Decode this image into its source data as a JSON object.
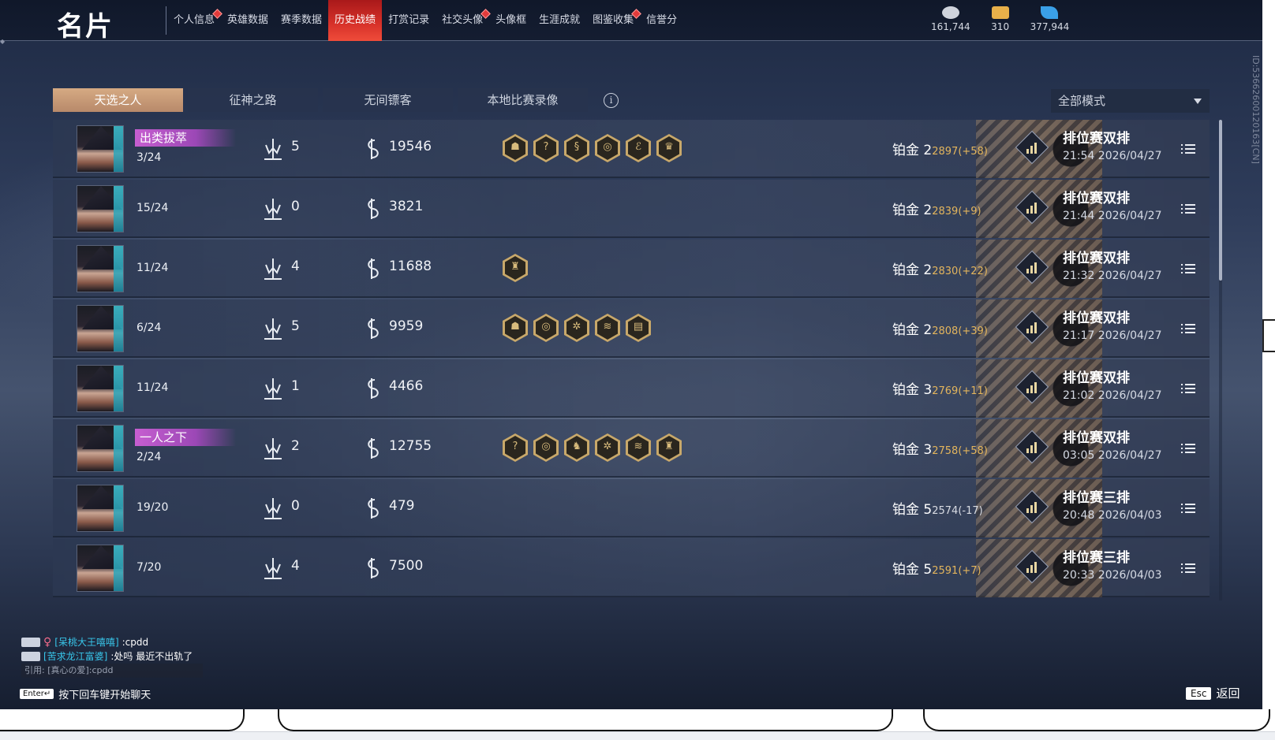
{
  "app": {
    "title": "名片",
    "nav": [
      {
        "label": "个人信息",
        "badge": true,
        "active": false
      },
      {
        "label": "英雄数据",
        "badge": false,
        "active": false
      },
      {
        "label": "赛季数据",
        "badge": false,
        "active": false
      },
      {
        "label": "历史战绩",
        "badge": false,
        "active": true
      },
      {
        "label": "打赏记录",
        "badge": false,
        "active": false
      },
      {
        "label": "社交头像",
        "badge": true,
        "active": false
      },
      {
        "label": "头像框",
        "badge": false,
        "active": false
      },
      {
        "label": "生涯成就",
        "badge": false,
        "active": false
      },
      {
        "label": "图鉴收集",
        "badge": true,
        "active": false
      },
      {
        "label": "信誉分",
        "badge": false,
        "active": false
      }
    ],
    "currencies": [
      {
        "icon": "coin-stack-icon",
        "value": "161,744"
      },
      {
        "icon": "ticket-icon",
        "value": "310"
      },
      {
        "icon": "feather-icon",
        "value": "377,944"
      }
    ],
    "side_id": "ID:536626001201​63[CN]"
  },
  "tabs": [
    {
      "label": "天选之人",
      "active": true
    },
    {
      "label": "征神之路",
      "active": false
    },
    {
      "label": "无间镖客",
      "active": false
    },
    {
      "label": "本地比赛录像",
      "active": false
    }
  ],
  "mode_select": {
    "value": "全部模式"
  },
  "matches": [
    {
      "title": "出类拔萃",
      "rank": "3/24",
      "kills": "5",
      "damage": "19546",
      "badges": [
        "☗",
        "?",
        "§",
        "◎",
        "ℰ",
        "♛"
      ],
      "tier": "铂金 2",
      "score": "2897(+58)",
      "negative": false,
      "mode": "排位赛双排",
      "time": "21:54  2026/04/27"
    },
    {
      "title": "",
      "rank": "15/24",
      "kills": "0",
      "damage": "3821",
      "badges": [],
      "tier": "铂金 2",
      "score": "2839(+9)",
      "negative": false,
      "mode": "排位赛双排",
      "time": "21:44  2026/04/27"
    },
    {
      "title": "",
      "rank": "11/24",
      "kills": "4",
      "damage": "11688",
      "badges": [
        "♜"
      ],
      "tier": "铂金 2",
      "score": "2830(+22)",
      "negative": false,
      "mode": "排位赛双排",
      "time": "21:32  2026/04/27"
    },
    {
      "title": "",
      "rank": "6/24",
      "kills": "5",
      "damage": "9959",
      "badges": [
        "☗",
        "◎",
        "✲",
        "≋",
        "▤"
      ],
      "tier": "铂金 2",
      "score": "2808(+39)",
      "negative": false,
      "mode": "排位赛双排",
      "time": "21:17  2026/04/27"
    },
    {
      "title": "",
      "rank": "11/24",
      "kills": "1",
      "damage": "4466",
      "badges": [],
      "tier": "铂金 3",
      "score": "2769(+11)",
      "negative": false,
      "mode": "排位赛双排",
      "time": "21:02  2026/04/27"
    },
    {
      "title": "一人之下",
      "rank": "2/24",
      "kills": "2",
      "damage": "12755",
      "badges": [
        "?",
        "◎",
        "♞",
        "✲",
        "≋",
        "♜"
      ],
      "tier": "铂金 3",
      "score": "2758(+58)",
      "negative": false,
      "mode": "排位赛双排",
      "time": "03:05  2026/04/27"
    },
    {
      "title": "",
      "rank": "19/20",
      "kills": "0",
      "damage": "479",
      "badges": [],
      "tier": "铂金 5",
      "score": "2574(-17)",
      "negative": true,
      "mode": "排位赛三排",
      "time": "20:48  2026/04/03"
    },
    {
      "title": "",
      "rank": "7/20",
      "kills": "4",
      "damage": "7500",
      "badges": [],
      "tier": "铂金 5",
      "score": "2591(+7)",
      "negative": false,
      "mode": "排位赛三排",
      "time": "20:33  2026/04/03"
    }
  ],
  "chat": {
    "lines": [
      {
        "name": "[呆桃大王嘻嘻]",
        "message": ":cpdd",
        "female": true
      },
      {
        "name": "[苦求龙江富婆]",
        "message": ":处吗 最近不出轨了",
        "female": false
      }
    ],
    "quote": "引用: [真心の爱]:cpdd",
    "enter_key": "Enter↵",
    "enter_hint": "按下回车键开始聊天"
  },
  "footer": {
    "esc_key": "Esc",
    "back_label": "返回"
  },
  "colors": {
    "accent_red": "#d8322a",
    "tab_active": "#c79a77",
    "score_gold": "#e3b55c",
    "title_purple": "#b152c4",
    "chat_name": "#38c6ea"
  }
}
